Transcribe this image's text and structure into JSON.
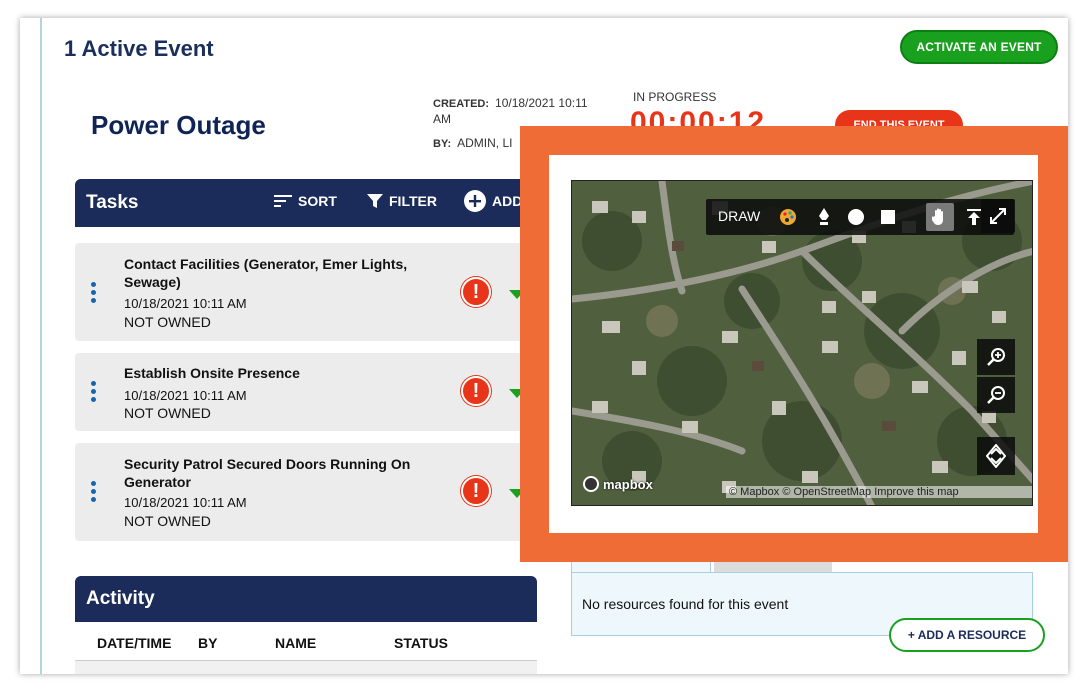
{
  "header": {
    "title": "1 Active Event",
    "activate_label": "ACTIVATE AN EVENT"
  },
  "event": {
    "title": "Power Outage",
    "created_label": "CREATED:",
    "created_value": "10/18/2021 10:11 AM",
    "by_label": "BY:",
    "by_value": "ADMIN, LI",
    "status": "IN PROGRESS",
    "timer": "00:00:12",
    "end_label": "END THIS EVENT"
  },
  "tasks": {
    "title": "Tasks",
    "sort_label": "SORT",
    "filter_label": "FILTER",
    "add_label": "ADD",
    "items": [
      {
        "name": "Contact Facilities (Generator, Emer Lights, Sewage)",
        "date": "10/18/2021 10:11 AM",
        "owner": "NOT OWNED",
        "alert": "!"
      },
      {
        "name": "Establish Onsite Presence",
        "date": "10/18/2021 10:11 AM",
        "owner": "NOT OWNED",
        "alert": "!"
      },
      {
        "name": "Security Patrol Secured Doors Running On Generator",
        "date": "10/18/2021 10:11 AM",
        "owner": "NOT OWNED",
        "alert": "!"
      }
    ]
  },
  "activity": {
    "title": "Activity",
    "columns": [
      "DATE/TIME",
      "BY",
      "NAME",
      "STATUS"
    ]
  },
  "map": {
    "draw_label": "DRAW",
    "logo_text": "mapbox",
    "attribution": "© Mapbox © OpenStreetMap Improve this map",
    "tools": [
      "palette-icon",
      "pen-icon",
      "circle-icon",
      "square-icon",
      "hand-icon",
      "upload-icon"
    ]
  },
  "resources": {
    "empty_text": "No resources found for this event",
    "add_label": "+ ADD A RESOURCE"
  },
  "colors": {
    "navy": "#1b2b5a",
    "green": "#1aa01f",
    "red": "#e8351a",
    "highlight": "#f06c36"
  }
}
